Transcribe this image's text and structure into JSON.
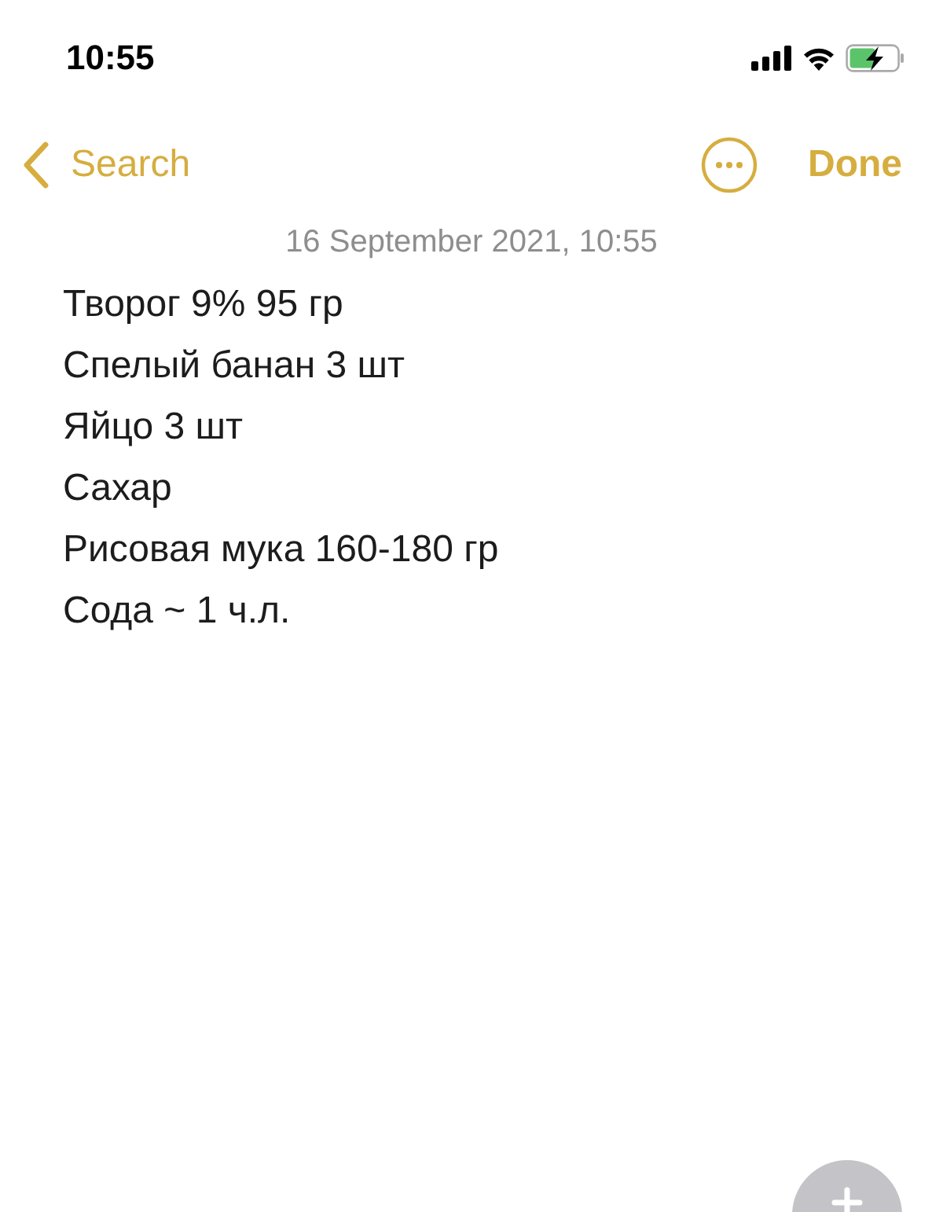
{
  "status_bar": {
    "time": "10:55"
  },
  "nav": {
    "back_label": "Search",
    "done_label": "Done"
  },
  "note": {
    "date": "16 September 2021, 10:55",
    "lines": [
      "Творог 9% 95 гр",
      "Спелый банан 3 шт",
      "Яйцо 3 шт",
      "Сахар",
      "Рисовая мука 160-180 гр",
      "Сода ~ 1 ч.л."
    ]
  }
}
